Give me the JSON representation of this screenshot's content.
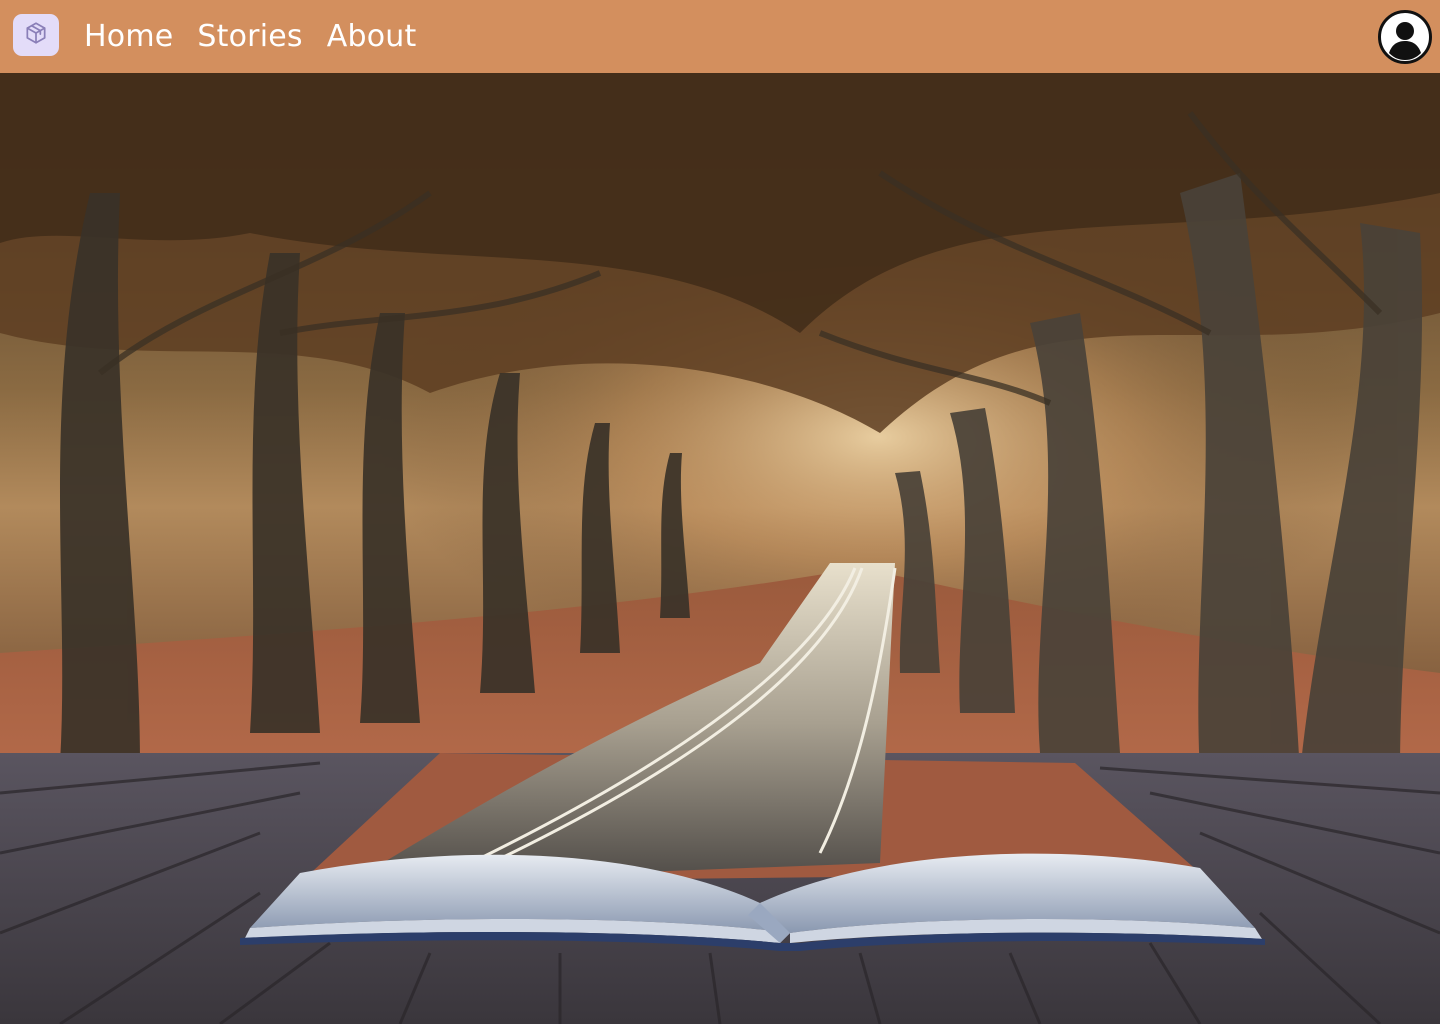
{
  "navbar": {
    "background": "#d38f5e",
    "logo_icon": "cube-icon",
    "links": [
      {
        "label": "Home"
      },
      {
        "label": "Stories"
      },
      {
        "label": "About"
      }
    ],
    "profile_icon": "user-circle-icon"
  },
  "hero": {
    "image_subject": "open book with an autumn tree-lined road rising from its pages on a wooden deck"
  }
}
